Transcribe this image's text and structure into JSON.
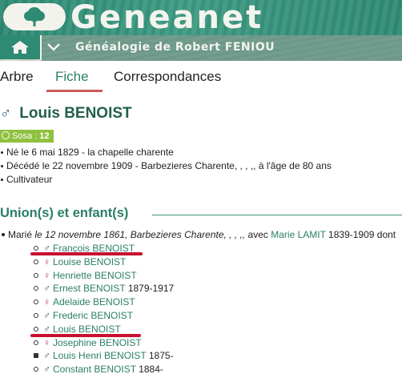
{
  "banner": {
    "logo_text": "Geneanet"
  },
  "nav": {
    "title": "Généalogie de Robert FENIOU"
  },
  "tabs": [
    {
      "label": "Arbre"
    },
    {
      "label": "Fiche"
    },
    {
      "label": "Correspondances"
    }
  ],
  "person": {
    "sex_symbol": "♂",
    "name": "Louis BENOIST",
    "sosa_label": "Sosa : ",
    "sosa_number": "12",
    "facts": [
      "Né le 6 mai 1829 - la chapelle charente",
      "Décédé le 22 novembre 1909 - Barbezieres Charente, , , ,, à l'âge de 80 ans",
      "Cultivateur"
    ]
  },
  "unions": {
    "title": "Union(s) et enfant(s)",
    "marriage": {
      "prefix": "Marié",
      "date_place": "le 12 novembre 1861, Barbezieres Charente, , , ,,",
      "with": "avec",
      "spouse": "Marie LAMIT",
      "spouse_dates": "1839-1909 dont"
    },
    "children": [
      {
        "sex": "♂",
        "sex_class": "m",
        "name": "François BENOIST",
        "dates": ""
      },
      {
        "sex": "♀",
        "sex_class": "f",
        "name": "Louise BENOIST",
        "dates": ""
      },
      {
        "sex": "♀",
        "sex_class": "f",
        "name": "Henriette BENOIST",
        "dates": ""
      },
      {
        "sex": "♂",
        "sex_class": "m",
        "name": "Ernest BENOIST",
        "dates": "1879-1917"
      },
      {
        "sex": "♀",
        "sex_class": "f",
        "name": "Adelaide BENOIST",
        "dates": ""
      },
      {
        "sex": "♂",
        "sex_class": "m",
        "name": "Frederic BENOIST",
        "dates": ""
      },
      {
        "sex": "♂",
        "sex_class": "m",
        "name": "Louis BENOIST",
        "dates": ""
      },
      {
        "sex": "♀",
        "sex_class": "f",
        "name": "Josephine BENOIST",
        "dates": ""
      },
      {
        "sex": "♂",
        "sex_class": "m",
        "name": "Louis Henri BENOIST",
        "dates": "1875-"
      },
      {
        "sex": "♂",
        "sex_class": "m",
        "name": "Constant BENOIST",
        "dates": "1884-"
      }
    ]
  },
  "colors": {
    "brand_green": "#2d8a73",
    "link_green": "#2a7f67",
    "male_blue": "#2f5d7d",
    "female_pink": "#c23d86",
    "sosa_green": "#8fc13f",
    "tab_underline": "#c95c57",
    "pen_red": "#c8102e"
  }
}
